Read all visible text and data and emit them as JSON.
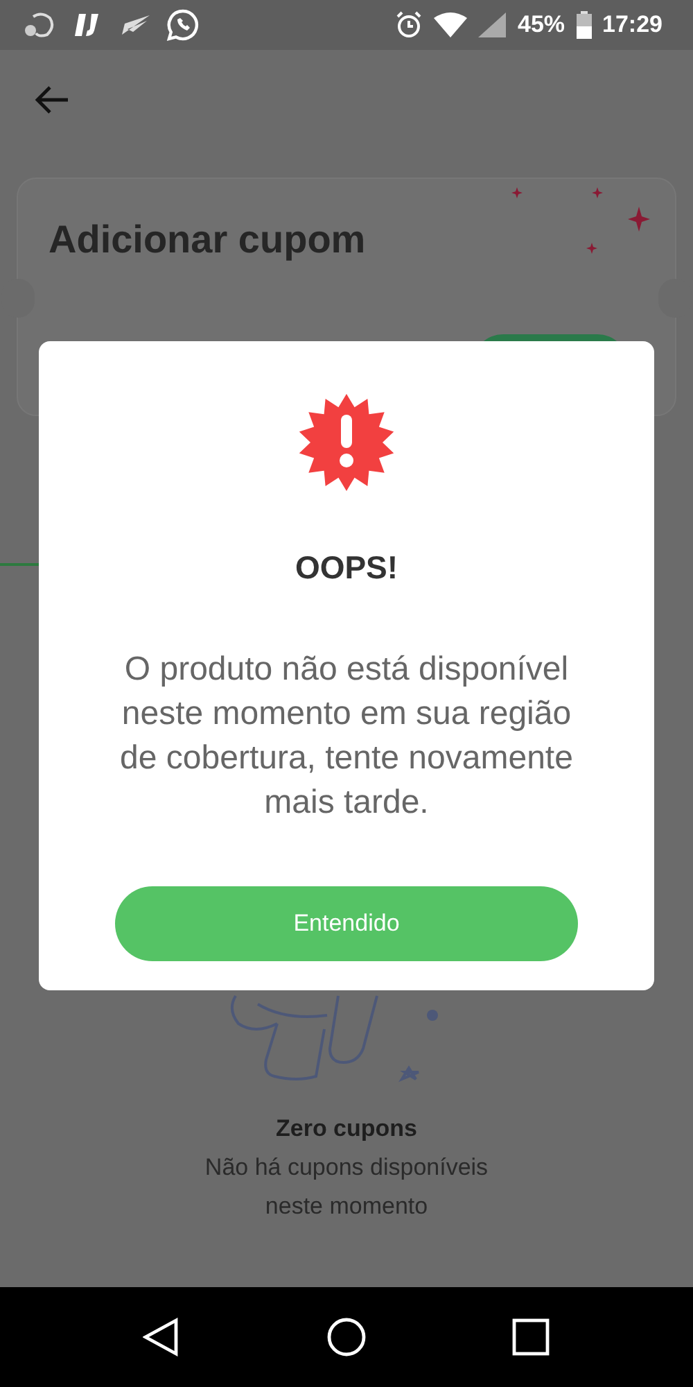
{
  "status_bar": {
    "battery": "45%",
    "time": "17:29"
  },
  "header": {
    "title": "Adicionar cupom"
  },
  "empty_state": {
    "title": "Zero cupons",
    "message": "Não há cupons disponíveis neste momento"
  },
  "dialog": {
    "title": "OOPS!",
    "message": "O produto não está disponível neste momento em sua região de cobertura, tente novamente mais tarde.",
    "button": "Entendido"
  }
}
